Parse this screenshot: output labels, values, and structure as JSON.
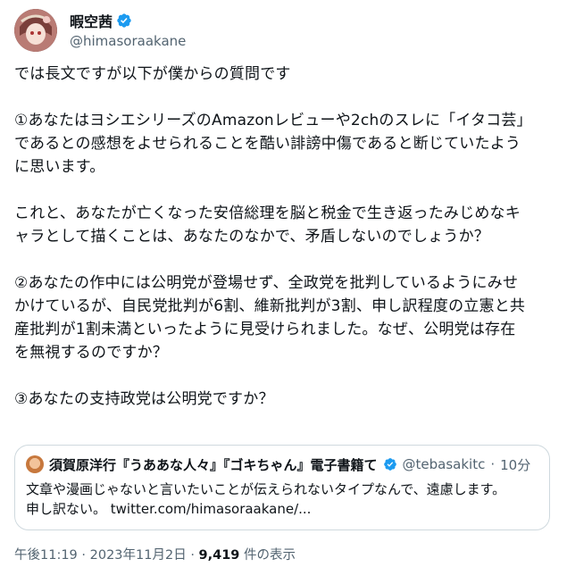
{
  "author": {
    "display_name": "暇空茜",
    "handle": "@himasoraakane"
  },
  "tweet": {
    "paragraphs": [
      [
        "では長文ですが以下が僕からの質問です"
      ],
      [
        "①あなたはヨシエシリーズのAmazonレビューや2chのスレに「イタコ芸」",
        "であるとの感想をよせられることを酷い誹謗中傷であると断じていたよう",
        "に思います。"
      ],
      [
        "これと、あなたが亡くなった安倍総理を脳と税金で生き返ったみじめなキ",
        "ャラとして描くことは、あなたのなかで、矛盾しないのでしょうか？"
      ],
      [
        "②あなたの作中には公明党が登場せず、全政党を批判しているようにみせ",
        "かけているが、自民党批判が6割、維新批判が3割、申し訳程度の立憲と共",
        "産批判が1割未満といったように見受けられました。なぜ、公明党は存在",
        "を無視するのですか？"
      ],
      [
        "③あなたの支持政党は公明党ですか？"
      ]
    ]
  },
  "quoted": {
    "display_name": "須賀原洋行『うああな人々』『ゴキちゃん』電子書籍て",
    "handle": "@tebasakitc",
    "dot": "·",
    "time": "10分",
    "text_line1": "文章や漫画じゃないと言いたいことが伝えられないタイプなんで、遠慮します。",
    "text_line2": "申し訳ない。 twitter.com/himasoraakane/..."
  },
  "meta": {
    "time": "午後11:19",
    "dot1": "·",
    "date": "2023年11月2日",
    "dot2": "·",
    "views_count": "9,419",
    "views_label": "件の表示"
  },
  "colors": {
    "verified_blue": "#1d9bf0",
    "secondary_text": "#536471",
    "border": "#cfd9de"
  },
  "icons": {
    "verified": "verified-badge-icon"
  }
}
